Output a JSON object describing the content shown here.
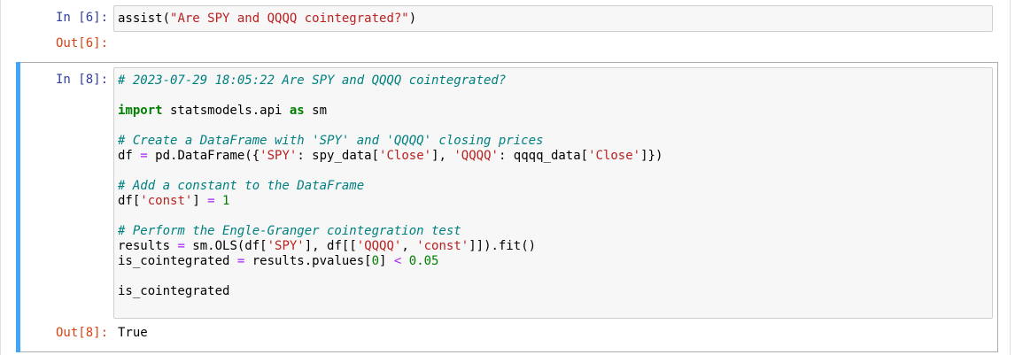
{
  "cells": [
    {
      "in_prompt": "In [6]:",
      "out_prompt": "Out[6]:",
      "code_line_1": {
        "fn": "assist(",
        "arg": "\"Are SPY and QQQQ cointegrated?\"",
        "close": ")"
      },
      "output": ""
    },
    {
      "in_prompt": "In [8]:",
      "out_prompt": "Out[8]:",
      "comment_header": "# 2023-07-29 18:05:22 Are SPY and QQQQ cointegrated?",
      "kw_import": "import",
      "mod": " statsmodels.api ",
      "kw_as": "as",
      "alias": " sm",
      "comment_df": "# Create a DataFrame with 'SPY' and 'QQQQ' closing prices",
      "df_line": {
        "p1": "df ",
        "eq": "=",
        "p2": " pd.DataFrame({",
        "s1": "'SPY'",
        "p3": ": spy_data[",
        "s2": "'Close'",
        "p4": "], ",
        "s3": "'QQQQ'",
        "p5": ": qqqq_data[",
        "s4": "'Close'",
        "p6": "]})"
      },
      "comment_const": "# Add a constant to the DataFrame",
      "const_line": {
        "p1": "df[",
        "s1": "'const'",
        "p2": "] ",
        "eq": "=",
        "sp": " ",
        "num": "1"
      },
      "comment_test": "# Perform the Engle-Granger cointegration test",
      "results_line": {
        "p1": "results ",
        "eq": "=",
        "p2": " sm.OLS(df[",
        "s1": "'SPY'",
        "p3": "], df[[",
        "s2": "'QQQQ'",
        "p4": ", ",
        "s3": "'const'",
        "p5": "]]).fit()"
      },
      "iscoint_line": {
        "p1": "is_cointegrated ",
        "eq": "=",
        "p2": " results.pvalues[",
        "num1": "0",
        "p3": "] ",
        "lt": "<",
        "sp": " ",
        "num2": "0.05"
      },
      "last_line": "is_cointegrated",
      "output": "True"
    }
  ],
  "colors": {
    "prompt_in": "#303f9f",
    "prompt_out": "#d84315",
    "selected_bar": "#42a5f5",
    "comment": "#008080",
    "keyword": "#008000",
    "string": "#ba2121",
    "operator": "#aa22ff"
  }
}
